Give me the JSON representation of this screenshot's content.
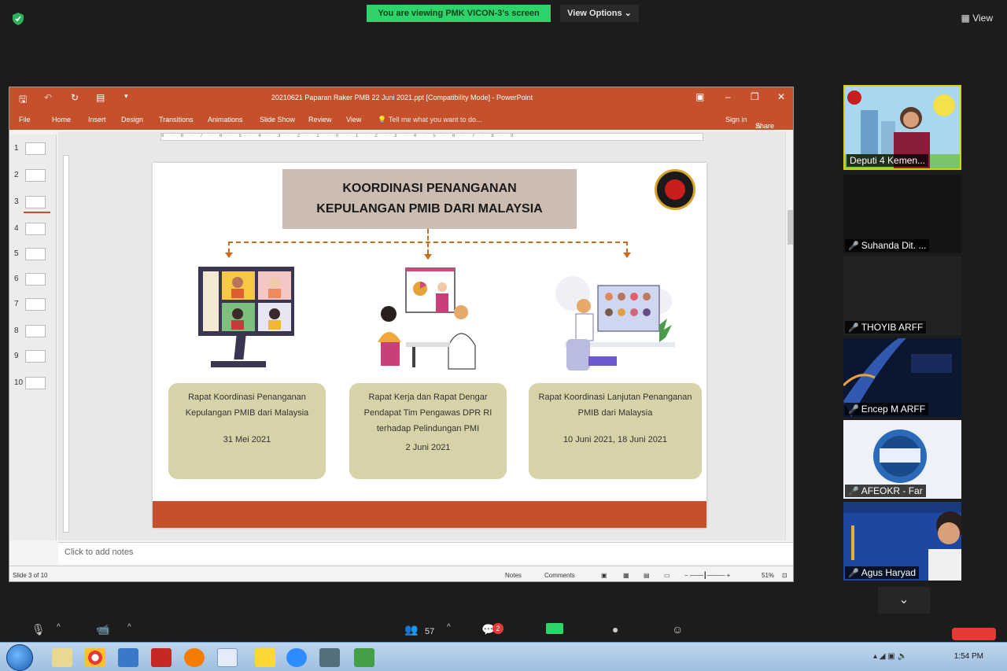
{
  "zoom": {
    "viewing_banner": "You are viewing PMK VICON-3's screen",
    "view_options": "View Options ⌄",
    "view_button": "View",
    "participants_count": "57",
    "chat_badge": "2"
  },
  "powerpoint": {
    "window_title": "20210621 Paparan Raker PMB 22 Juni 2021.ppt [Compatibility Mode] - PowerPoint",
    "tabs": [
      "File",
      "Home",
      "Insert",
      "Design",
      "Transitions",
      "Animations",
      "Slide Show",
      "Review",
      "View"
    ],
    "tell_me": "Tell me what you want to do...",
    "sign_in": "Sign in",
    "share": "Share",
    "notes_placeholder": "Click to add notes",
    "status_slide": "Slide 3 of 10",
    "status_notes": "Notes",
    "status_comments": "Comments",
    "zoom_level": "51%",
    "ruler_text": "9 · 8 · 7 · 6 · 5 · 4 · 3 · 2 · 1 · 0 · 1 · 2 · 3 · 4 · 5 · 6 · 7 · 8 · 9",
    "thumbnails": [
      "1",
      "2",
      "3",
      "4",
      "5",
      "6",
      "7",
      "8",
      "9",
      "10"
    ],
    "active_slide": 3
  },
  "slide": {
    "title_line1": "KOORDINASI PENANGANAN",
    "title_line2": "KEPULANGAN PMIB DARI MALAYSIA",
    "cards": [
      {
        "text": "Rapat Koordinasi Penanganan Kepulangan PMIB dari Malaysia",
        "date": "31 Mei 2021"
      },
      {
        "text": "Rapat Kerja dan Rapat Dengar Pendapat Tim Pengawas DPR RI terhadap Pelindungan PMI",
        "date": "2 Juni 2021"
      },
      {
        "text": "Rapat Koordinasi Lanjutan Penanganan PMIB dari Malaysia",
        "date": "10 Juni 2021, 18 Juni 2021"
      }
    ]
  },
  "participants": [
    {
      "name": "Deputi 4 Kemen..."
    },
    {
      "name": "Suhanda Dit. ..."
    },
    {
      "name": "THOYIB ARFF"
    },
    {
      "name": "Encep M ARFF"
    },
    {
      "name": "AFEOKR - Far"
    },
    {
      "name": "Agus Haryad"
    }
  ],
  "taskbar": {
    "time": "1:54 PM"
  }
}
